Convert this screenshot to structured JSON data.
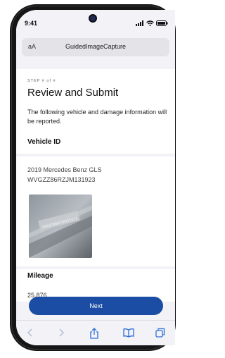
{
  "status": {
    "time": "9:41"
  },
  "url_bar": {
    "aa": "aA",
    "title": "GuidedImageCapture"
  },
  "page": {
    "step": "STEP # of #",
    "title": "Review and Submit",
    "description": "The following vehicle and damage information will be reported."
  },
  "vehicle": {
    "section_title": "Vehicle ID",
    "model": "2019 Mercedes Benz GLS",
    "vin": "WVGZZ86RZJM131923",
    "photo_text": "WVGZZ86RZJM131923"
  },
  "mileage": {
    "section_title": "Mileage",
    "value": "25,876"
  },
  "actions": {
    "next_label": "Next"
  },
  "colors": {
    "accent": "#1a4da3",
    "background": "#f2f2f7"
  },
  "toolbar_icons": [
    "back-icon",
    "forward-icon",
    "share-icon",
    "bookmarks-icon",
    "tabs-icon"
  ]
}
